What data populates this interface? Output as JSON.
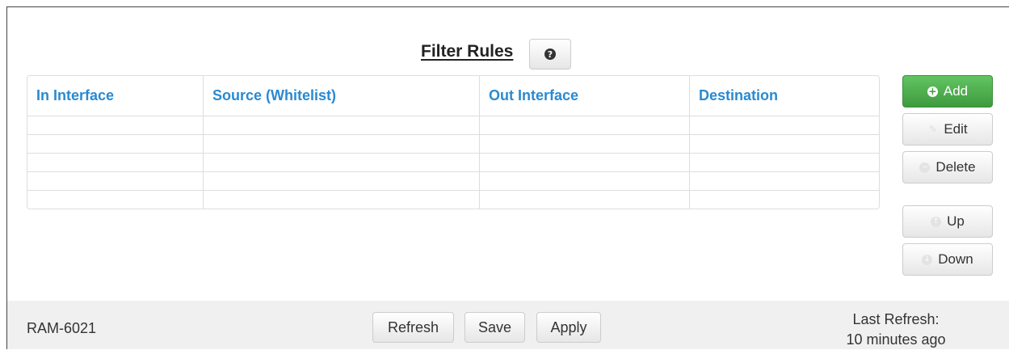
{
  "header": {
    "title": "Filter Rules",
    "help_glyph": "?"
  },
  "table": {
    "columns": [
      "In Interface",
      "Source (Whitelist)",
      "Out Interface",
      "Destination"
    ],
    "rows": [
      [
        "",
        "",
        "",
        ""
      ],
      [
        "",
        "",
        "",
        ""
      ],
      [
        "",
        "",
        "",
        ""
      ],
      [
        "",
        "",
        "",
        ""
      ],
      [
        "",
        "",
        "",
        ""
      ]
    ]
  },
  "actions": {
    "add": "Add",
    "edit": "Edit",
    "delete": "Delete",
    "up": "Up",
    "down": "Down"
  },
  "footer": {
    "device": "RAM-6021",
    "refresh": "Refresh",
    "save": "Save",
    "apply": "Apply",
    "last_refresh_label": "Last Refresh:",
    "last_refresh_value": "10 minutes ago"
  },
  "colors": {
    "accent": "#2a8ad0",
    "add_button": "#4cae4c"
  }
}
